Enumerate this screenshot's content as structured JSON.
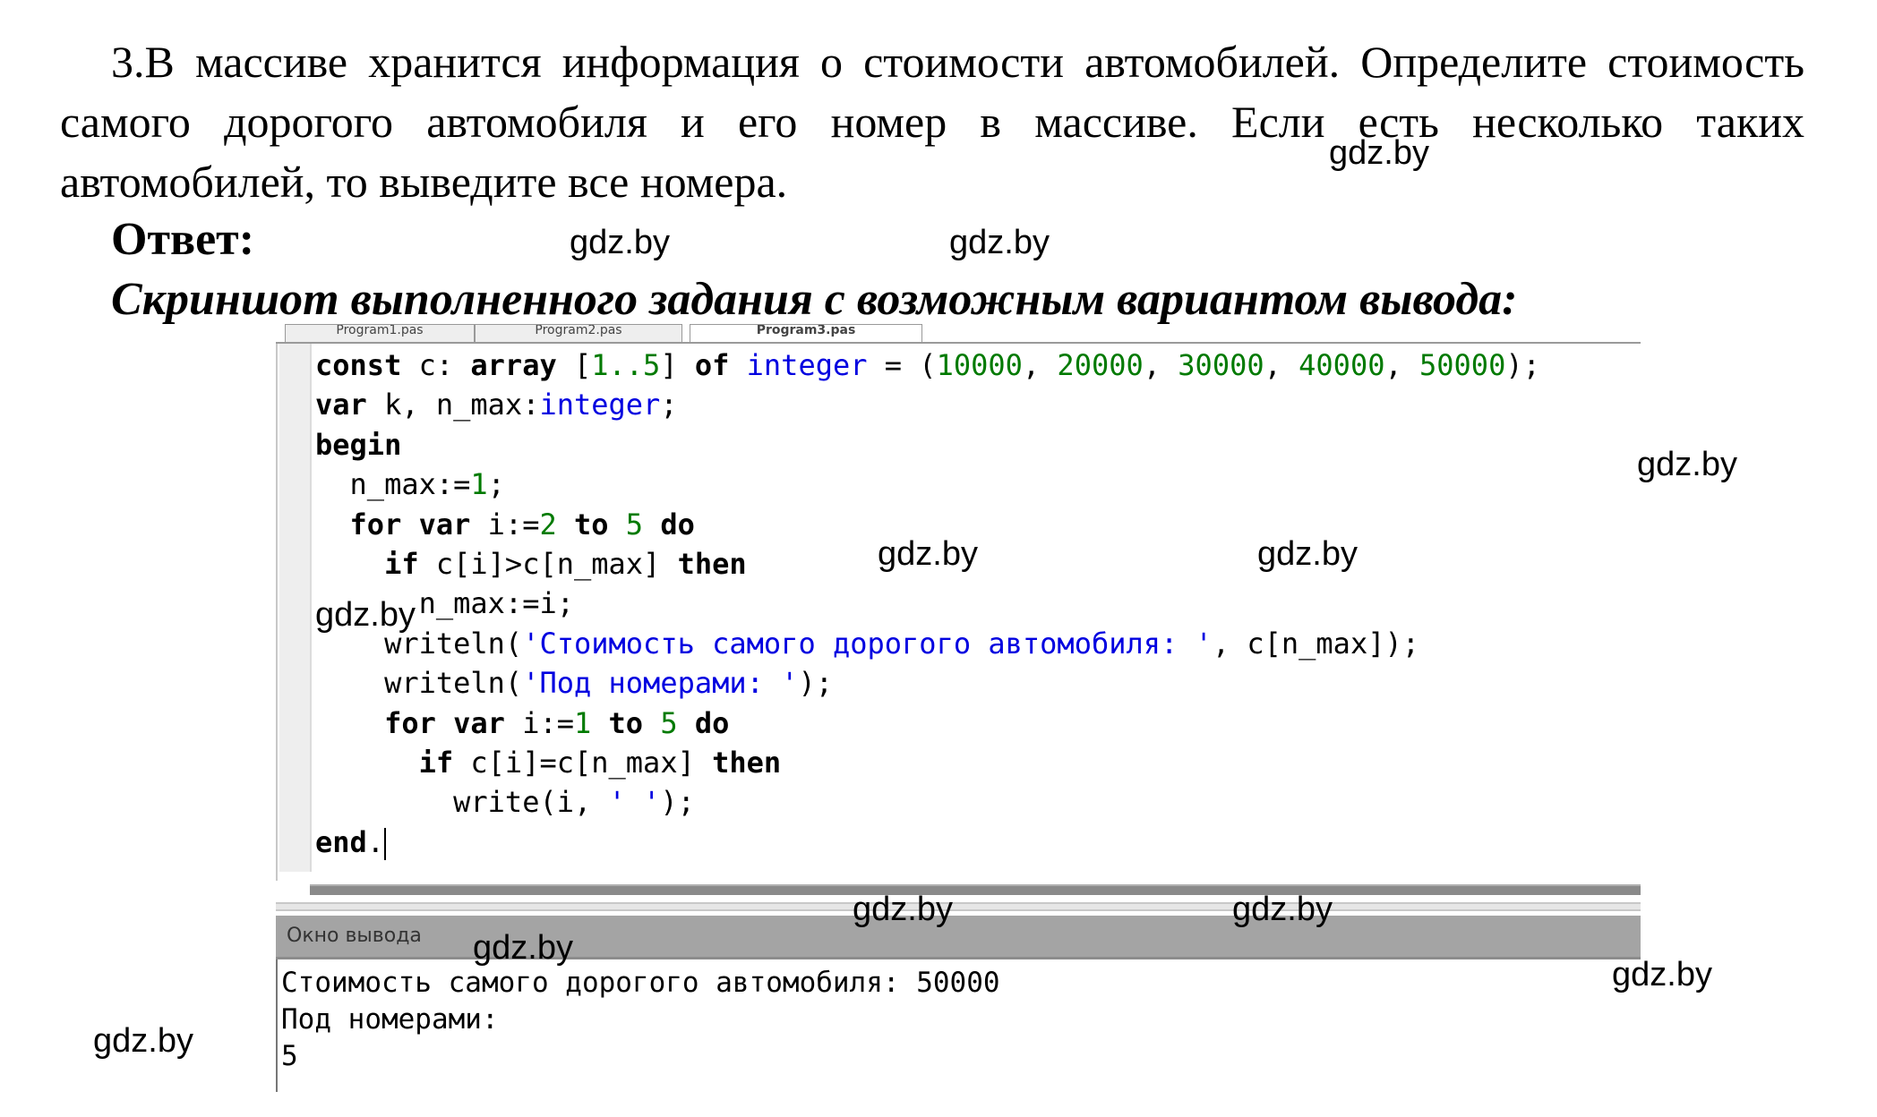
{
  "task": {
    "text": "3.В массиве хранится информация о стоимости автомобилей. Определите стоимость самого дорогого автомобиля и его номер в массиве. Если есть несколько таких автомобилей, то выведите все номера.",
    "answer_label": "Ответ:",
    "caption": "Скриншот выполненного задания с возможным вариантом вывода:"
  },
  "ide": {
    "tabs": [
      "Program1.pas",
      "Program2.pas",
      "Program3.pas"
    ],
    "active_tab": 2,
    "code_lines": [
      [
        [
          "kw",
          "const"
        ],
        [
          "t",
          " c: "
        ],
        [
          "kw",
          "array"
        ],
        [
          "t",
          " ["
        ],
        [
          "num",
          "1..5"
        ],
        [
          "t",
          "] "
        ],
        [
          "kw",
          "of"
        ],
        [
          "t",
          " "
        ],
        [
          "ty",
          "integer"
        ],
        [
          "t",
          " = ("
        ],
        [
          "num",
          "10000"
        ],
        [
          "t",
          ", "
        ],
        [
          "num",
          "20000"
        ],
        [
          "t",
          ", "
        ],
        [
          "num",
          "30000"
        ],
        [
          "t",
          ", "
        ],
        [
          "num",
          "40000"
        ],
        [
          "t",
          ", "
        ],
        [
          "num",
          "50000"
        ],
        [
          "t",
          ");"
        ]
      ],
      [
        [
          "kw",
          "var"
        ],
        [
          "t",
          " k, n_max:"
        ],
        [
          "ty",
          "integer"
        ],
        [
          "t",
          ";"
        ]
      ],
      [
        [
          "kw",
          "begin"
        ]
      ],
      [
        [
          "t",
          "  n_max:="
        ],
        [
          "num",
          "1"
        ],
        [
          "t",
          ";"
        ]
      ],
      [
        [
          "t",
          "  "
        ],
        [
          "kw",
          "for"
        ],
        [
          "t",
          " "
        ],
        [
          "kw",
          "var"
        ],
        [
          "t",
          " i:="
        ],
        [
          "num",
          "2"
        ],
        [
          "t",
          " "
        ],
        [
          "kw",
          "to"
        ],
        [
          "t",
          " "
        ],
        [
          "num",
          "5"
        ],
        [
          "t",
          " "
        ],
        [
          "kw",
          "do"
        ]
      ],
      [
        [
          "t",
          "    "
        ],
        [
          "kw",
          "if"
        ],
        [
          "t",
          " c[i]>c[n_max] "
        ],
        [
          "kw",
          "then"
        ]
      ],
      [
        [
          "t",
          "      n_max:=i;"
        ]
      ],
      [
        [
          "t",
          "    writeln("
        ],
        [
          "str",
          "'Стоимость самого дорогого автомобиля: '"
        ],
        [
          "t",
          ", c[n_max]);"
        ]
      ],
      [
        [
          "t",
          "    writeln("
        ],
        [
          "str",
          "'Под номерами: '"
        ],
        [
          "t",
          ");"
        ]
      ],
      [
        [
          "t",
          "    "
        ],
        [
          "kw",
          "for"
        ],
        [
          "t",
          " "
        ],
        [
          "kw",
          "var"
        ],
        [
          "t",
          " i:="
        ],
        [
          "num",
          "1"
        ],
        [
          "t",
          " "
        ],
        [
          "kw",
          "to"
        ],
        [
          "t",
          " "
        ],
        [
          "num",
          "5"
        ],
        [
          "t",
          " "
        ],
        [
          "kw",
          "do"
        ]
      ],
      [
        [
          "t",
          "      "
        ],
        [
          "kw",
          "if"
        ],
        [
          "t",
          " c[i]=c[n_max] "
        ],
        [
          "kw",
          "then"
        ]
      ],
      [
        [
          "t",
          "        write(i, "
        ],
        [
          "str",
          "' '"
        ],
        [
          "t",
          ");"
        ]
      ],
      [
        [
          "kw",
          "end"
        ],
        [
          "t",
          "."
        ]
      ]
    ],
    "output_title": "Окно вывода",
    "output_lines": [
      "Стоимость самого дорогого автомобиля: 50000",
      "Под номерами:",
      "5"
    ],
    "colors": {
      "keyword": "#000000",
      "type": "#0000e0",
      "number": "#007a00",
      "string": "#0000e0"
    }
  },
  "watermark": {
    "text": "gdz.by"
  }
}
